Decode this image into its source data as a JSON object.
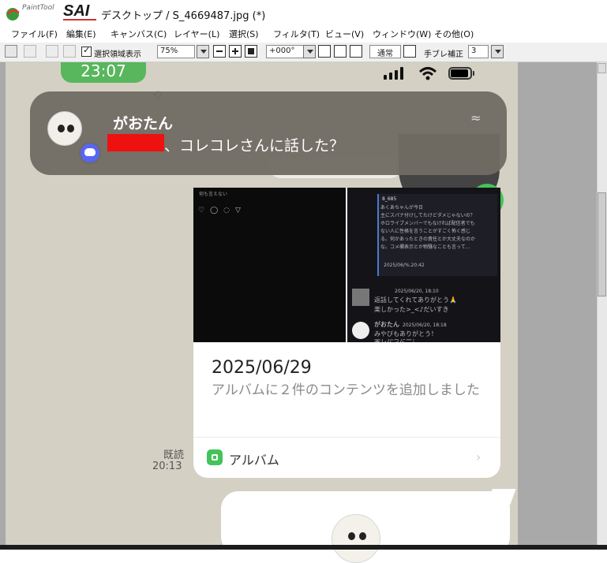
{
  "window": {
    "logo_small": "PaintTool",
    "logo_main": "SAI",
    "title": "デスクトップ / S_4669487.jpg (*)"
  },
  "menu": [
    "ファイル(F)",
    "編集(E)",
    "キャンバス(C)",
    "レイヤー(L)",
    "選択(S)",
    "フィルタ(T)",
    "ビュー(V)",
    "ウィンドウ(W)",
    "その他(O)"
  ],
  "toolbar": {
    "selection_checkbox_label": "選択領域表示",
    "selection_checked": true,
    "zoom": "75%",
    "rotation": "+000°",
    "blend_mode": "通常",
    "stabilizer_label": "手ブレ補正",
    "stabilizer_value": "3"
  },
  "phone": {
    "clock": "23:07",
    "notification": {
      "sender": "がおたん",
      "message": "、コレコレさんに話した？",
      "app_icon": "discord-icon"
    },
    "album_card": {
      "preview_header_left": "何も言えない",
      "preview_tweet_user": "8_685",
      "preview_tweet_lines": [
        "あくあちゃんが今日",
        "主にスパナ付けしてたけどダメじゃないの？",
        "ホロライブメンバーでもなければ配信者でも",
        "ない人に性格を言うことがすごく怖く感じ",
        "る。何かあったときの責任とか大丈夫なのか",
        "な。コメ欄表示とか物騒なことも言って…"
      ],
      "preview_tweet_date": "2025/06/%.20:42",
      "preview_reply1_date": "2025/06/20, 18:10",
      "preview_reply1_lines": [
        "返話してくれてありがとう🙏",
        "楽しかった>_<♪だいすき"
      ],
      "preview_reply2_name": "がおたん",
      "preview_reply2_date": "2025/06/20, 18:18",
      "preview_reply2_lines": [
        "みやびもありがとう！",
        "楽しかったー！"
      ],
      "date": "2025/06/29",
      "description": "アルバムに２件のコンテンツを追加しました",
      "link_label": "アルバム"
    },
    "read_label": "既読",
    "read_time": "20:13"
  },
  "colors": {
    "accent_green": "#45c25a",
    "clock_green": "#58b65c",
    "discord_blue": "#5865f2",
    "redaction_red": "#ef1010",
    "chat_bg": "#d4d0c3"
  }
}
